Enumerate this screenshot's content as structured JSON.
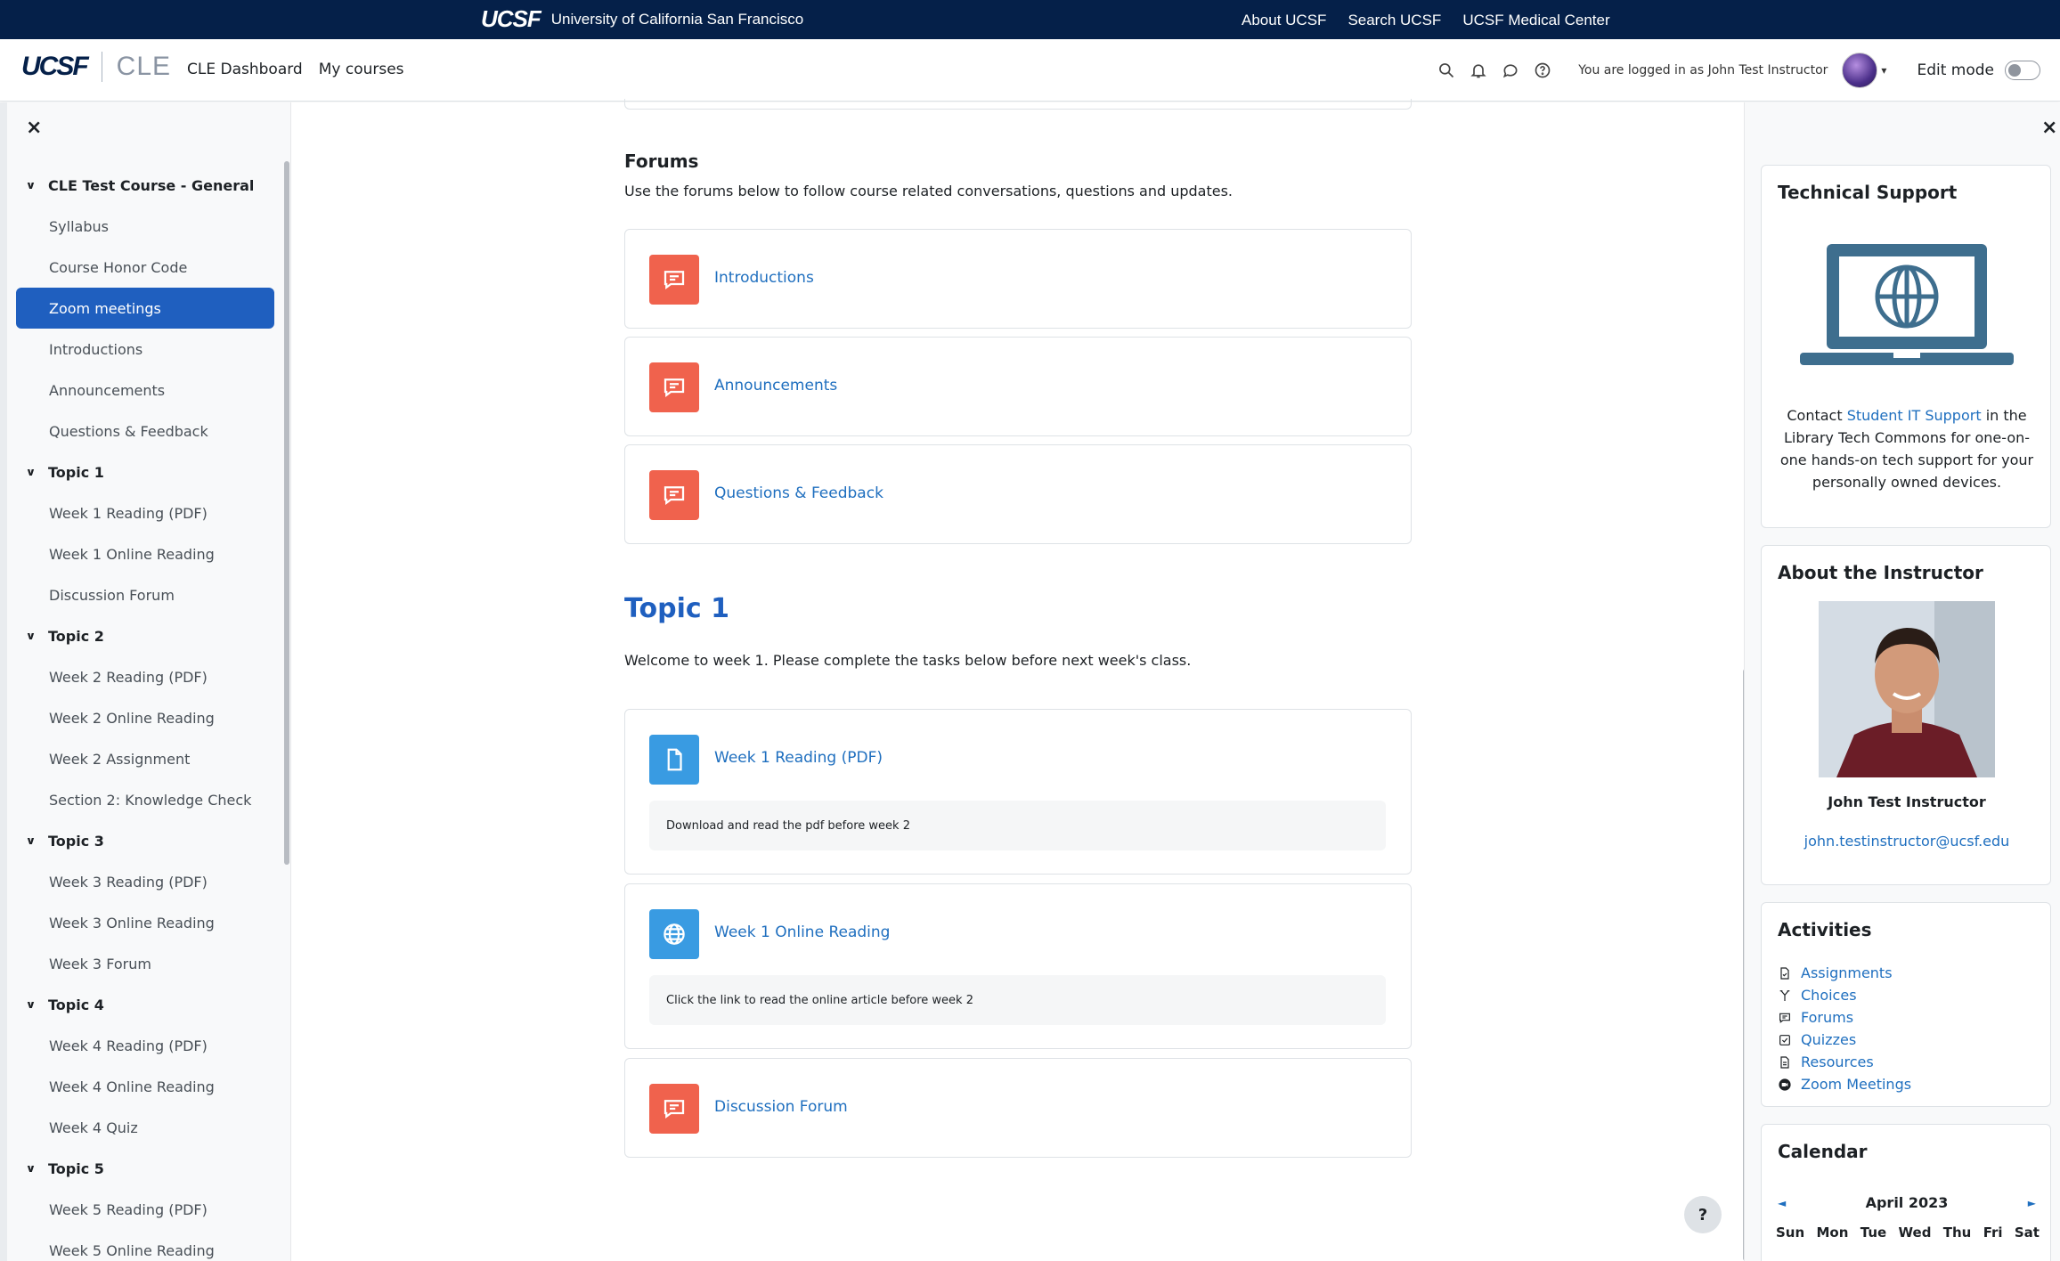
{
  "topbar": {
    "logo_text": "UCSF",
    "university_name": "University of California San Francisco",
    "links": [
      "About UCSF",
      "Search UCSF",
      "UCSF Medical Center"
    ]
  },
  "navbar": {
    "logo_ucsf": "UCSF",
    "logo_cle": "CLE",
    "links": [
      "CLE Dashboard",
      "My courses"
    ],
    "logged_in_text": "You are logged in as John Test Instructor",
    "edit_mode_label": "Edit mode",
    "edit_mode_on": false
  },
  "left_drawer": {
    "close_symbol": "×",
    "course_index": [
      {
        "type": "section",
        "label": "CLE Test Course - General"
      },
      {
        "type": "item",
        "label": "Syllabus"
      },
      {
        "type": "item",
        "label": "Course Honor Code"
      },
      {
        "type": "item",
        "label": "Zoom meetings",
        "active": true
      },
      {
        "type": "item",
        "label": "Introductions"
      },
      {
        "type": "item",
        "label": "Announcements"
      },
      {
        "type": "item",
        "label": "Questions & Feedback"
      },
      {
        "type": "section",
        "label": "Topic 1"
      },
      {
        "type": "item",
        "label": "Week 1 Reading (PDF)"
      },
      {
        "type": "item",
        "label": "Week 1 Online Reading"
      },
      {
        "type": "item",
        "label": "Discussion Forum"
      },
      {
        "type": "section",
        "label": "Topic 2"
      },
      {
        "type": "item",
        "label": "Week 2 Reading (PDF)"
      },
      {
        "type": "item",
        "label": "Week 2 Online Reading"
      },
      {
        "type": "item",
        "label": "Week 2 Assignment"
      },
      {
        "type": "item",
        "label": "Section 2: Knowledge Check"
      },
      {
        "type": "section",
        "label": "Topic 3"
      },
      {
        "type": "item",
        "label": "Week 3 Reading (PDF)"
      },
      {
        "type": "item",
        "label": "Week 3 Online Reading"
      },
      {
        "type": "item",
        "label": "Week 3 Forum"
      },
      {
        "type": "section",
        "label": "Topic 4"
      },
      {
        "type": "item",
        "label": "Week 4 Reading (PDF)"
      },
      {
        "type": "item",
        "label": "Week 4 Online Reading"
      },
      {
        "type": "item",
        "label": "Week 4 Quiz"
      },
      {
        "type": "section",
        "label": "Topic 5"
      },
      {
        "type": "item",
        "label": "Week 5 Reading (PDF)"
      },
      {
        "type": "item",
        "label": "Week 5 Online Reading"
      }
    ]
  },
  "main": {
    "forums_section": {
      "title": "Forums",
      "summary": "Use the forums below to follow course related conversations, questions and updates.",
      "activities": [
        {
          "name": "Introductions",
          "icon": "forum-icon"
        },
        {
          "name": "Announcements",
          "icon": "forum-icon"
        },
        {
          "name": "Questions & Feedback",
          "icon": "forum-icon"
        }
      ]
    },
    "topic1": {
      "title": "Topic 1",
      "summary": "Welcome to week 1. Please complete the tasks below before next week's class.",
      "activities": [
        {
          "name": "Week 1 Reading (PDF)",
          "icon": "file-icon",
          "description": "Download and read the pdf before week 2"
        },
        {
          "name": "Week 1 Online Reading",
          "icon": "globe-icon",
          "description": "Click the link to read the online article before week 2"
        },
        {
          "name": "Discussion Forum",
          "icon": "forum-icon"
        }
      ]
    },
    "help_symbol": "?"
  },
  "right_drawer": {
    "close_symbol": "×",
    "technical_support": {
      "title": "Technical Support",
      "text_before": "Contact ",
      "link_text": "Student IT Support",
      "text_after": " in the Library Tech Commons for one-on-one hands-on tech support for your personally owned devices."
    },
    "about_instructor": {
      "title": "About the Instructor",
      "name": "John Test Instructor",
      "email": "john.testinstructor@ucsf.edu"
    },
    "activities": {
      "title": "Activities",
      "items": [
        "Assignments",
        "Choices",
        "Forums",
        "Quizzes",
        "Resources",
        "Zoom Meetings"
      ]
    },
    "calendar": {
      "title": "Calendar",
      "month": "April 2023",
      "prev_symbol": "◄",
      "next_symbol": "►",
      "days": [
        "Sun",
        "Mon",
        "Tue",
        "Wed",
        "Thu",
        "Fri",
        "Sat"
      ]
    }
  },
  "colors": {
    "ucsf_navy": "#052049",
    "link_blue": "#1f6fbf",
    "active_blue": "#1f5fbf",
    "forum_icon_bg": "#f0624d",
    "resource_icon_bg": "#399be2"
  }
}
